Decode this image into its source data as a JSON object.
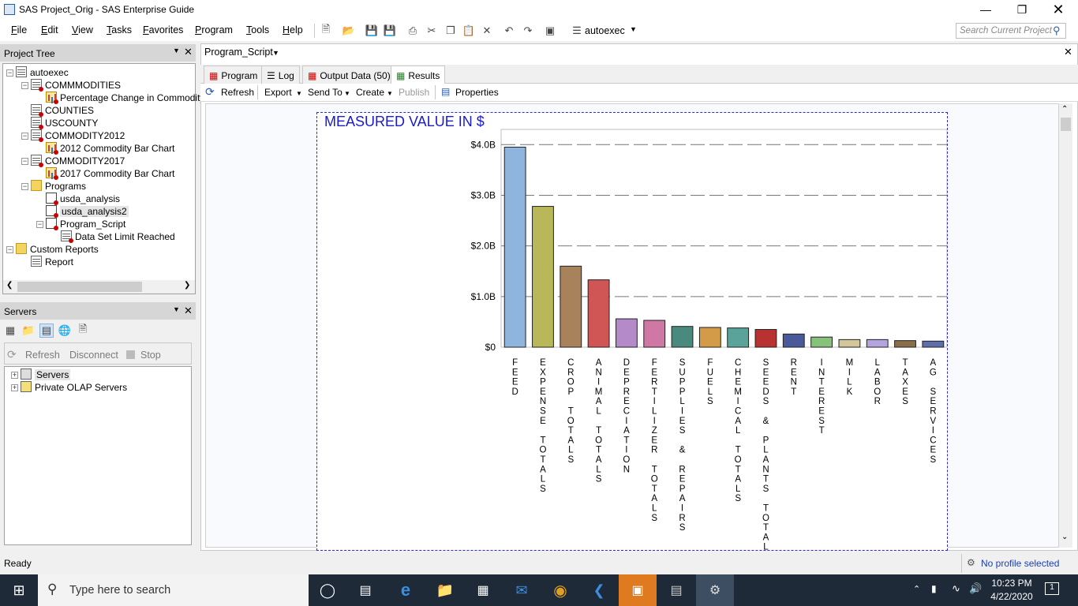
{
  "window": {
    "title": "SAS Project_Orig - SAS Enterprise Guide"
  },
  "menu": [
    "File",
    "Edit",
    "View",
    "Tasks",
    "Favorites",
    "Program",
    "Tools",
    "Help"
  ],
  "toolbar": {
    "autoexec_label": "autoexec",
    "search_placeholder": "Search Current Project"
  },
  "project_tree": {
    "title": "Project Tree",
    "items": [
      {
        "label": "autoexec",
        "depth": 0,
        "icon": "flow-icon"
      },
      {
        "label": "COMMMODITIES",
        "depth": 1,
        "icon": "dataset-icon"
      },
      {
        "label": "Percentage Change in Commodity",
        "depth": 2,
        "icon": "chart-icon"
      },
      {
        "label": "COUNTIES",
        "depth": 1,
        "icon": "dataset-icon"
      },
      {
        "label": "USCOUNTY",
        "depth": 1,
        "icon": "dataset-icon"
      },
      {
        "label": "COMMODITY2012",
        "depth": 1,
        "icon": "dataset-icon"
      },
      {
        "label": "2012 Commodity Bar Chart",
        "depth": 2,
        "icon": "chart-icon"
      },
      {
        "label": "COMMODITY2017",
        "depth": 1,
        "icon": "dataset-icon"
      },
      {
        "label": "2017 Commodity Bar Chart",
        "depth": 2,
        "icon": "chart-icon"
      },
      {
        "label": "Programs",
        "depth": 1,
        "icon": "folder-icon"
      },
      {
        "label": "usda_analysis",
        "depth": 2,
        "icon": "program-icon"
      },
      {
        "label": "usda_analysis2",
        "depth": 2,
        "icon": "program-icon"
      },
      {
        "label": "Program_Script",
        "depth": 2,
        "icon": "program-icon"
      },
      {
        "label": "Data Set Limit Reached",
        "depth": 3,
        "icon": "dataset-icon"
      },
      {
        "label": "Custom Reports",
        "depth": 0,
        "icon": "folder-icon"
      },
      {
        "label": "Report",
        "depth": 1,
        "icon": "report-icon"
      }
    ]
  },
  "servers": {
    "title": "Servers",
    "actions": {
      "refresh": "Refresh",
      "disconnect": "Disconnect",
      "stop": "Stop"
    },
    "items": [
      "Servers",
      "Private OLAP Servers"
    ]
  },
  "document": {
    "title": "Program_Script",
    "tabs": [
      "Program",
      "Log",
      "Output Data (50)",
      "Results"
    ],
    "actions": {
      "refresh": "Refresh",
      "export": "Export",
      "send_to": "Send To",
      "create": "Create",
      "publish": "Publish",
      "properties": "Properties"
    }
  },
  "chart_data": {
    "type": "bar",
    "title": "MEASURED VALUE IN $",
    "ylim": [
      0,
      4300000000
    ],
    "yticks": [
      "$0",
      "$1.0B",
      "$2.0B",
      "$3.0B",
      "$4.0B"
    ],
    "ytick_values": [
      0,
      1000000000,
      2000000000,
      3000000000,
      4000000000
    ],
    "grid": true,
    "categories": [
      "FEED",
      "EXPENSE TOTALS",
      "CROP TOTALS",
      "ANIMAL TOTALS",
      "DEPRECIATION",
      "FERTILIZER TOTALS",
      "SUPPLIES & REPAIRS",
      "FUELS",
      "CHEMICAL TOTALS",
      "SEEDS & PLANTS TOTAL",
      "RENT",
      "INTEREST",
      "MILK",
      "LABOR",
      "TAXES",
      "AG SERVICES"
    ],
    "values": [
      3950000000,
      2780000000,
      1600000000,
      1330000000,
      560000000,
      530000000,
      410000000,
      390000000,
      380000000,
      350000000,
      260000000,
      200000000,
      150000000,
      150000000,
      130000000,
      120000000
    ],
    "colors": [
      "#8fb4dd",
      "#b8b85a",
      "#a8825a",
      "#d05656",
      "#b48ac8",
      "#cf78a6",
      "#4a8a7e",
      "#d39a48",
      "#5aa39a",
      "#b83232",
      "#4a5a98",
      "#86c27a",
      "#d2c69a",
      "#b4a4de",
      "#8a6e4a",
      "#5e6ea8"
    ]
  },
  "status": {
    "left": "Ready",
    "profile": "No profile selected"
  },
  "taskbar": {
    "search_placeholder": "Type here to search",
    "time": "10:23 PM",
    "date": "4/22/2020",
    "notifications": "1"
  }
}
